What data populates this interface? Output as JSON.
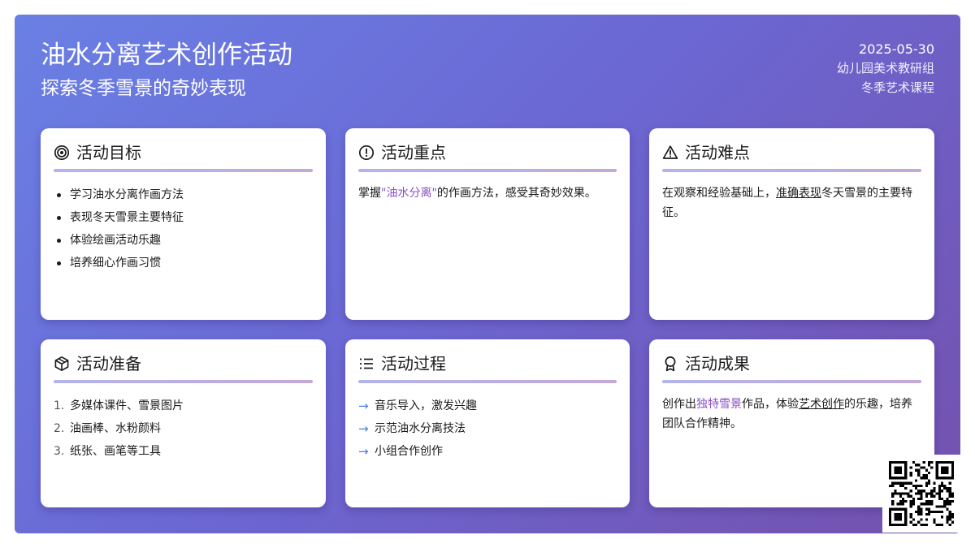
{
  "header": {
    "title": "油水分离艺术创作活动",
    "subtitle": "探索冬季雪景的奇妙表现",
    "date": "2025-05-30",
    "group": "幼儿园美术教研组",
    "course": "冬季艺术课程"
  },
  "cards": {
    "goals": {
      "title": "活动目标",
      "icon": "target-icon",
      "items": [
        "学习油水分离作画方法",
        "表现冬天雪景主要特征",
        "体验绘画活动乐趣",
        "培养细心作画习惯"
      ]
    },
    "focus": {
      "title": "活动重点",
      "icon": "alert-circle-icon",
      "text_before": "掌握",
      "highlight": "\"油水分离\"",
      "text_after": "的作画方法，感受其奇妙效果。"
    },
    "difficulty": {
      "title": "活动难点",
      "icon": "warning-triangle-icon",
      "text_before": "在观察和经验基础上，",
      "underline": "准确表现",
      "text_after": "冬天雪景的主要特征。"
    },
    "prep": {
      "title": "活动准备",
      "icon": "box-icon",
      "items": [
        "多媒体课件、雪景图片",
        "油画棒、水粉颜料",
        "纸张、画笔等工具"
      ],
      "numbers": [
        "1.",
        "2.",
        "3."
      ]
    },
    "process": {
      "title": "活动过程",
      "icon": "list-icon",
      "items": [
        "音乐导入，激发兴趣",
        "示范油水分离技法",
        "小组合作创作"
      ],
      "arrow": "→"
    },
    "result": {
      "title": "活动成果",
      "icon": "award-icon",
      "text_before": "创作出",
      "highlight": "独特雪景",
      "text_mid": "作品，体验",
      "underline": "艺术创作",
      "text_after": "的乐趣，培养团队合作精神。"
    }
  },
  "qr_code": {
    "icon": "qr-code-icon"
  },
  "colors": {
    "gradient_start": "#6a80e4",
    "gradient_end": "#7451ad",
    "highlight": "#8a4fc8",
    "arrow": "#4a7fd8",
    "rule_start": "#b3b4ee",
    "rule_end": "#c2a9d8"
  }
}
